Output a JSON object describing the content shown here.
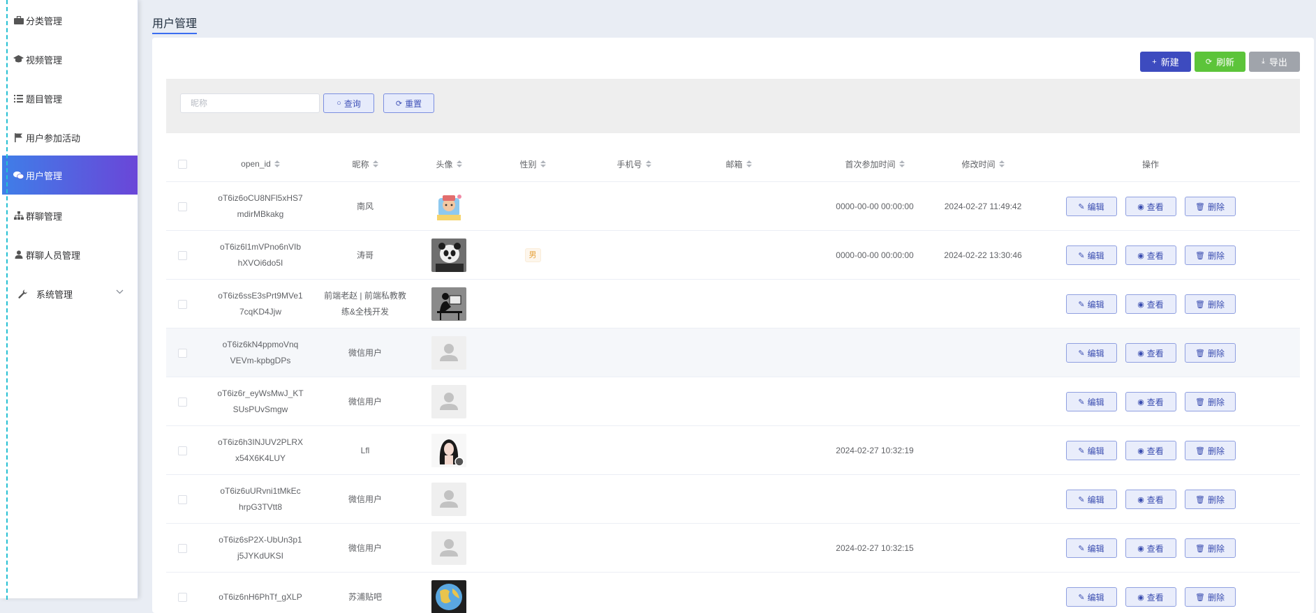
{
  "sidebar": {
    "items": [
      {
        "label": "分类管理",
        "icon": "briefcase-icon"
      },
      {
        "label": "视频管理",
        "icon": "graduation-cap-icon"
      },
      {
        "label": "题目管理",
        "icon": "list-icon"
      },
      {
        "label": "用户参加活动",
        "icon": "flag-icon"
      },
      {
        "label": "用户管理",
        "icon": "chat-bubbles-icon",
        "active": true
      },
      {
        "label": "群聊管理",
        "icon": "sitemap-icon"
      },
      {
        "label": "群聊人员管理",
        "icon": "user-icon"
      },
      {
        "label": "系统管理",
        "icon": "wrench-icon",
        "expandable": true
      }
    ]
  },
  "page": {
    "title": "用户管理"
  },
  "toolbar": {
    "new_label": "新建",
    "refresh_label": "刷新",
    "export_label": "导出"
  },
  "search": {
    "placeholder": "昵称",
    "query_label": "查询",
    "reset_label": "重置"
  },
  "table": {
    "columns": [
      "open_id",
      "昵称",
      "头像",
      "性别",
      "手机号",
      "邮箱",
      "首次参加时间",
      "修改时间",
      "操作"
    ],
    "actions": {
      "edit": "编辑",
      "view": "查看",
      "delete": "删除"
    },
    "rows": [
      {
        "open_id_1": "oT6iz6oCU8NFl5xHS7",
        "open_id_2": "mdirMBkakg",
        "nickname": "南风",
        "avatar": "cartoon",
        "gender": "",
        "phone": "",
        "email": "",
        "first_time": "0000-00-00 00:00:00",
        "modified": "2024-02-27 11:49:42"
      },
      {
        "open_id_1": "oT6iz6l1mVPno6nVIb",
        "open_id_2": "hXVOi6do5I",
        "nickname": "涛哥",
        "avatar": "panda",
        "gender": "男",
        "phone": "",
        "email": "",
        "first_time": "0000-00-00 00:00:00",
        "modified": "2024-02-22 13:30:46"
      },
      {
        "open_id_1": "oT6iz6ssE3sPrt9MVe1",
        "open_id_2": "7cqKD4Jjw",
        "nickname_1": "前端老赵 | 前端私教教",
        "nickname_2": "练&全栈开发",
        "avatar": "desk",
        "gender": "",
        "phone": "",
        "email": "",
        "first_time": "",
        "modified": ""
      },
      {
        "open_id_1": "oT6iz6kN4ppmoVnq",
        "open_id_2": "VEVm-kpbgDPs",
        "nickname": "微信用户",
        "avatar": "default",
        "gender": "",
        "phone": "",
        "email": "",
        "first_time": "",
        "modified": ""
      },
      {
        "open_id_1": "oT6iz6r_eyWsMwJ_KT",
        "open_id_2": "SUsPUvSmgw",
        "nickname": "微信用户",
        "avatar": "default",
        "gender": "",
        "phone": "",
        "email": "",
        "first_time": "",
        "modified": ""
      },
      {
        "open_id_1": "oT6iz6h3INJUV2PLRX",
        "open_id_2": "x54X6K4LUY",
        "nickname": "Lfl",
        "avatar": "girl",
        "gender": "",
        "phone": "",
        "email": "",
        "first_time": "2024-02-27 10:32:19",
        "modified": ""
      },
      {
        "open_id_1": "oT6iz6uURvni1tMkEc",
        "open_id_2": "hrpG3TVtt8",
        "nickname": "微信用户",
        "avatar": "default",
        "gender": "",
        "phone": "",
        "email": "",
        "first_time": "",
        "modified": ""
      },
      {
        "open_id_1": "oT6iz6sP2X-UbUn3p1",
        "open_id_2": "j5JYKdUKSI",
        "nickname": "微信用户",
        "avatar": "default",
        "gender": "",
        "phone": "",
        "email": "",
        "first_time": "2024-02-27 10:32:15",
        "modified": ""
      },
      {
        "open_id_1": "oT6iz6nH6PhTf_gXLP",
        "open_id_2": "",
        "nickname": "苏浦贴吧",
        "avatar": "globe",
        "gender": "",
        "phone": "",
        "email": "",
        "first_time": "",
        "modified": ""
      }
    ]
  },
  "colors": {
    "accent": "#3d4bbf",
    "refresh": "#5cc43a",
    "export": "#a0a4ab",
    "active_menu_start": "#3f7ee8",
    "active_menu_end": "#6a46d8"
  }
}
